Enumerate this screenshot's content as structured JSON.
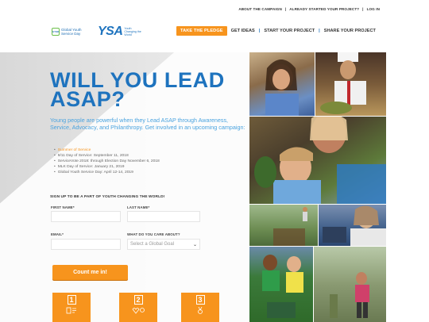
{
  "top_links": {
    "about": "ABOUT THE CAMPAIGN",
    "started": "ALREADY STARTED YOUR PROJECT?",
    "login": "LOG IN",
    "separator": "|"
  },
  "logos": {
    "gysd_badge": "GYSD",
    "gysd_text": "Global Youth Service Day",
    "ysa": "YSA",
    "ysa_tagline": "Youth Changing the World"
  },
  "nav": {
    "pledge": "TAKE THE PLEDGE",
    "ideas": "GET IDEAS",
    "start": "START YOUR PROJECT",
    "share": "SHARE YOUR PROJECT",
    "separator": "|"
  },
  "hero": {
    "headline_line1": "WILL YOU LEAD",
    "headline_line2": "ASAP?",
    "intro": "Young people are powerful when they Lead ASAP through Awareness, Service, Advocacy, and Philanthropy. Get involved in an upcoming campaign:",
    "campaigns": [
      "Summer of Service",
      "9/11 Day of Service: September 11, 2018",
      "ServiceVote 2018: through Election Day November 6, 2018",
      "MLK Day of Service: January 21, 2019",
      "Global Youth Service Day: April 12-14, 2019"
    ]
  },
  "form": {
    "title": "SIGN UP TO BE A PART OF YOUTH CHANGING THE WORLD!",
    "first_name_label": "FIRST NAME*",
    "last_name_label": "LAST NAME*",
    "email_label": "EMAIL*",
    "care_label": "WHAT DO YOU CARE ABOUT?",
    "care_placeholder": "Select a Global Goal",
    "submit": "Count me in!"
  },
  "steps": [
    {
      "number": "1",
      "icon": "checklist-icon"
    },
    {
      "number": "2",
      "icon": "heart-icon"
    },
    {
      "number": "3",
      "icon": "medal-icon"
    }
  ],
  "colors": {
    "brand_blue": "#1e73be",
    "accent_orange": "#f7941d",
    "text_blue": "#4aa3df"
  }
}
